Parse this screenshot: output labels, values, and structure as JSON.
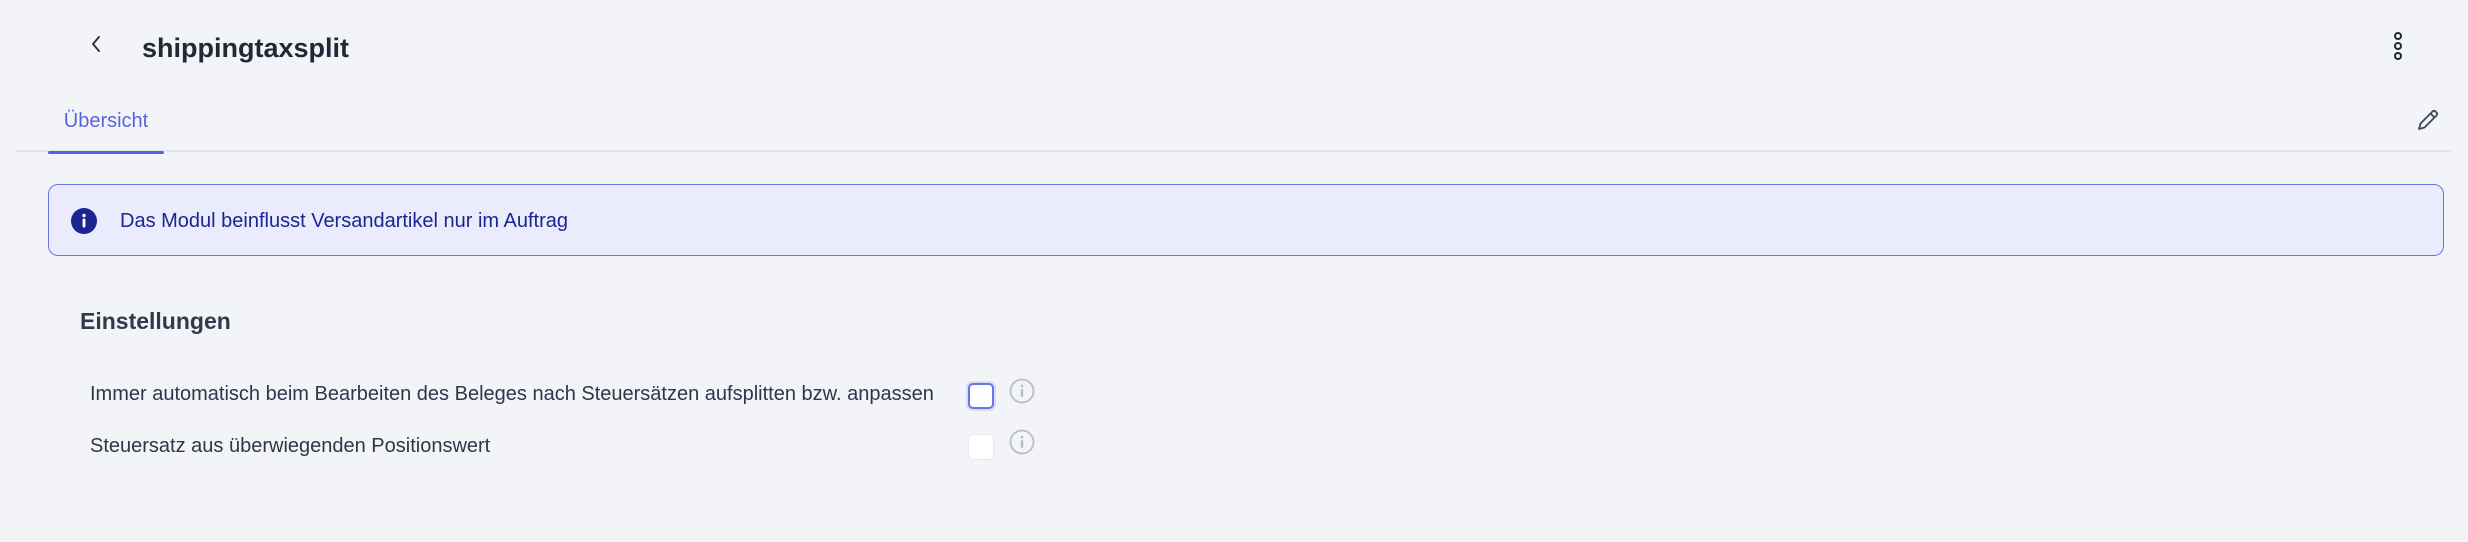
{
  "header": {
    "title": "shippingtaxsplit",
    "back_icon": "chevron-left-icon",
    "more_icon": "more-vertical-icon"
  },
  "tabs": [
    {
      "label": "Übersicht",
      "active": true
    }
  ],
  "toolbar": {
    "edit_icon": "pencil-icon"
  },
  "info_banner": {
    "icon": "info-icon",
    "text": "Das Modul beinflusst Versandartikel nur im Auftrag"
  },
  "settings": {
    "title": "Einstellungen",
    "items": [
      {
        "label": "Immer automatisch beim Bearbeiten des Beleges nach Steuersätzen aufsplitten bzw. anpassen",
        "checked": false,
        "help_icon": "info-circle-icon"
      },
      {
        "label": "Steuersatz aus überwiegenden Positionswert",
        "checked": false,
        "help_icon": "info-circle-icon"
      }
    ]
  },
  "colors": {
    "accent": "#5865d8",
    "banner_bg": "#eaecfd",
    "banner_text": "#1b2590",
    "page_bg": "#f3f4f8"
  }
}
